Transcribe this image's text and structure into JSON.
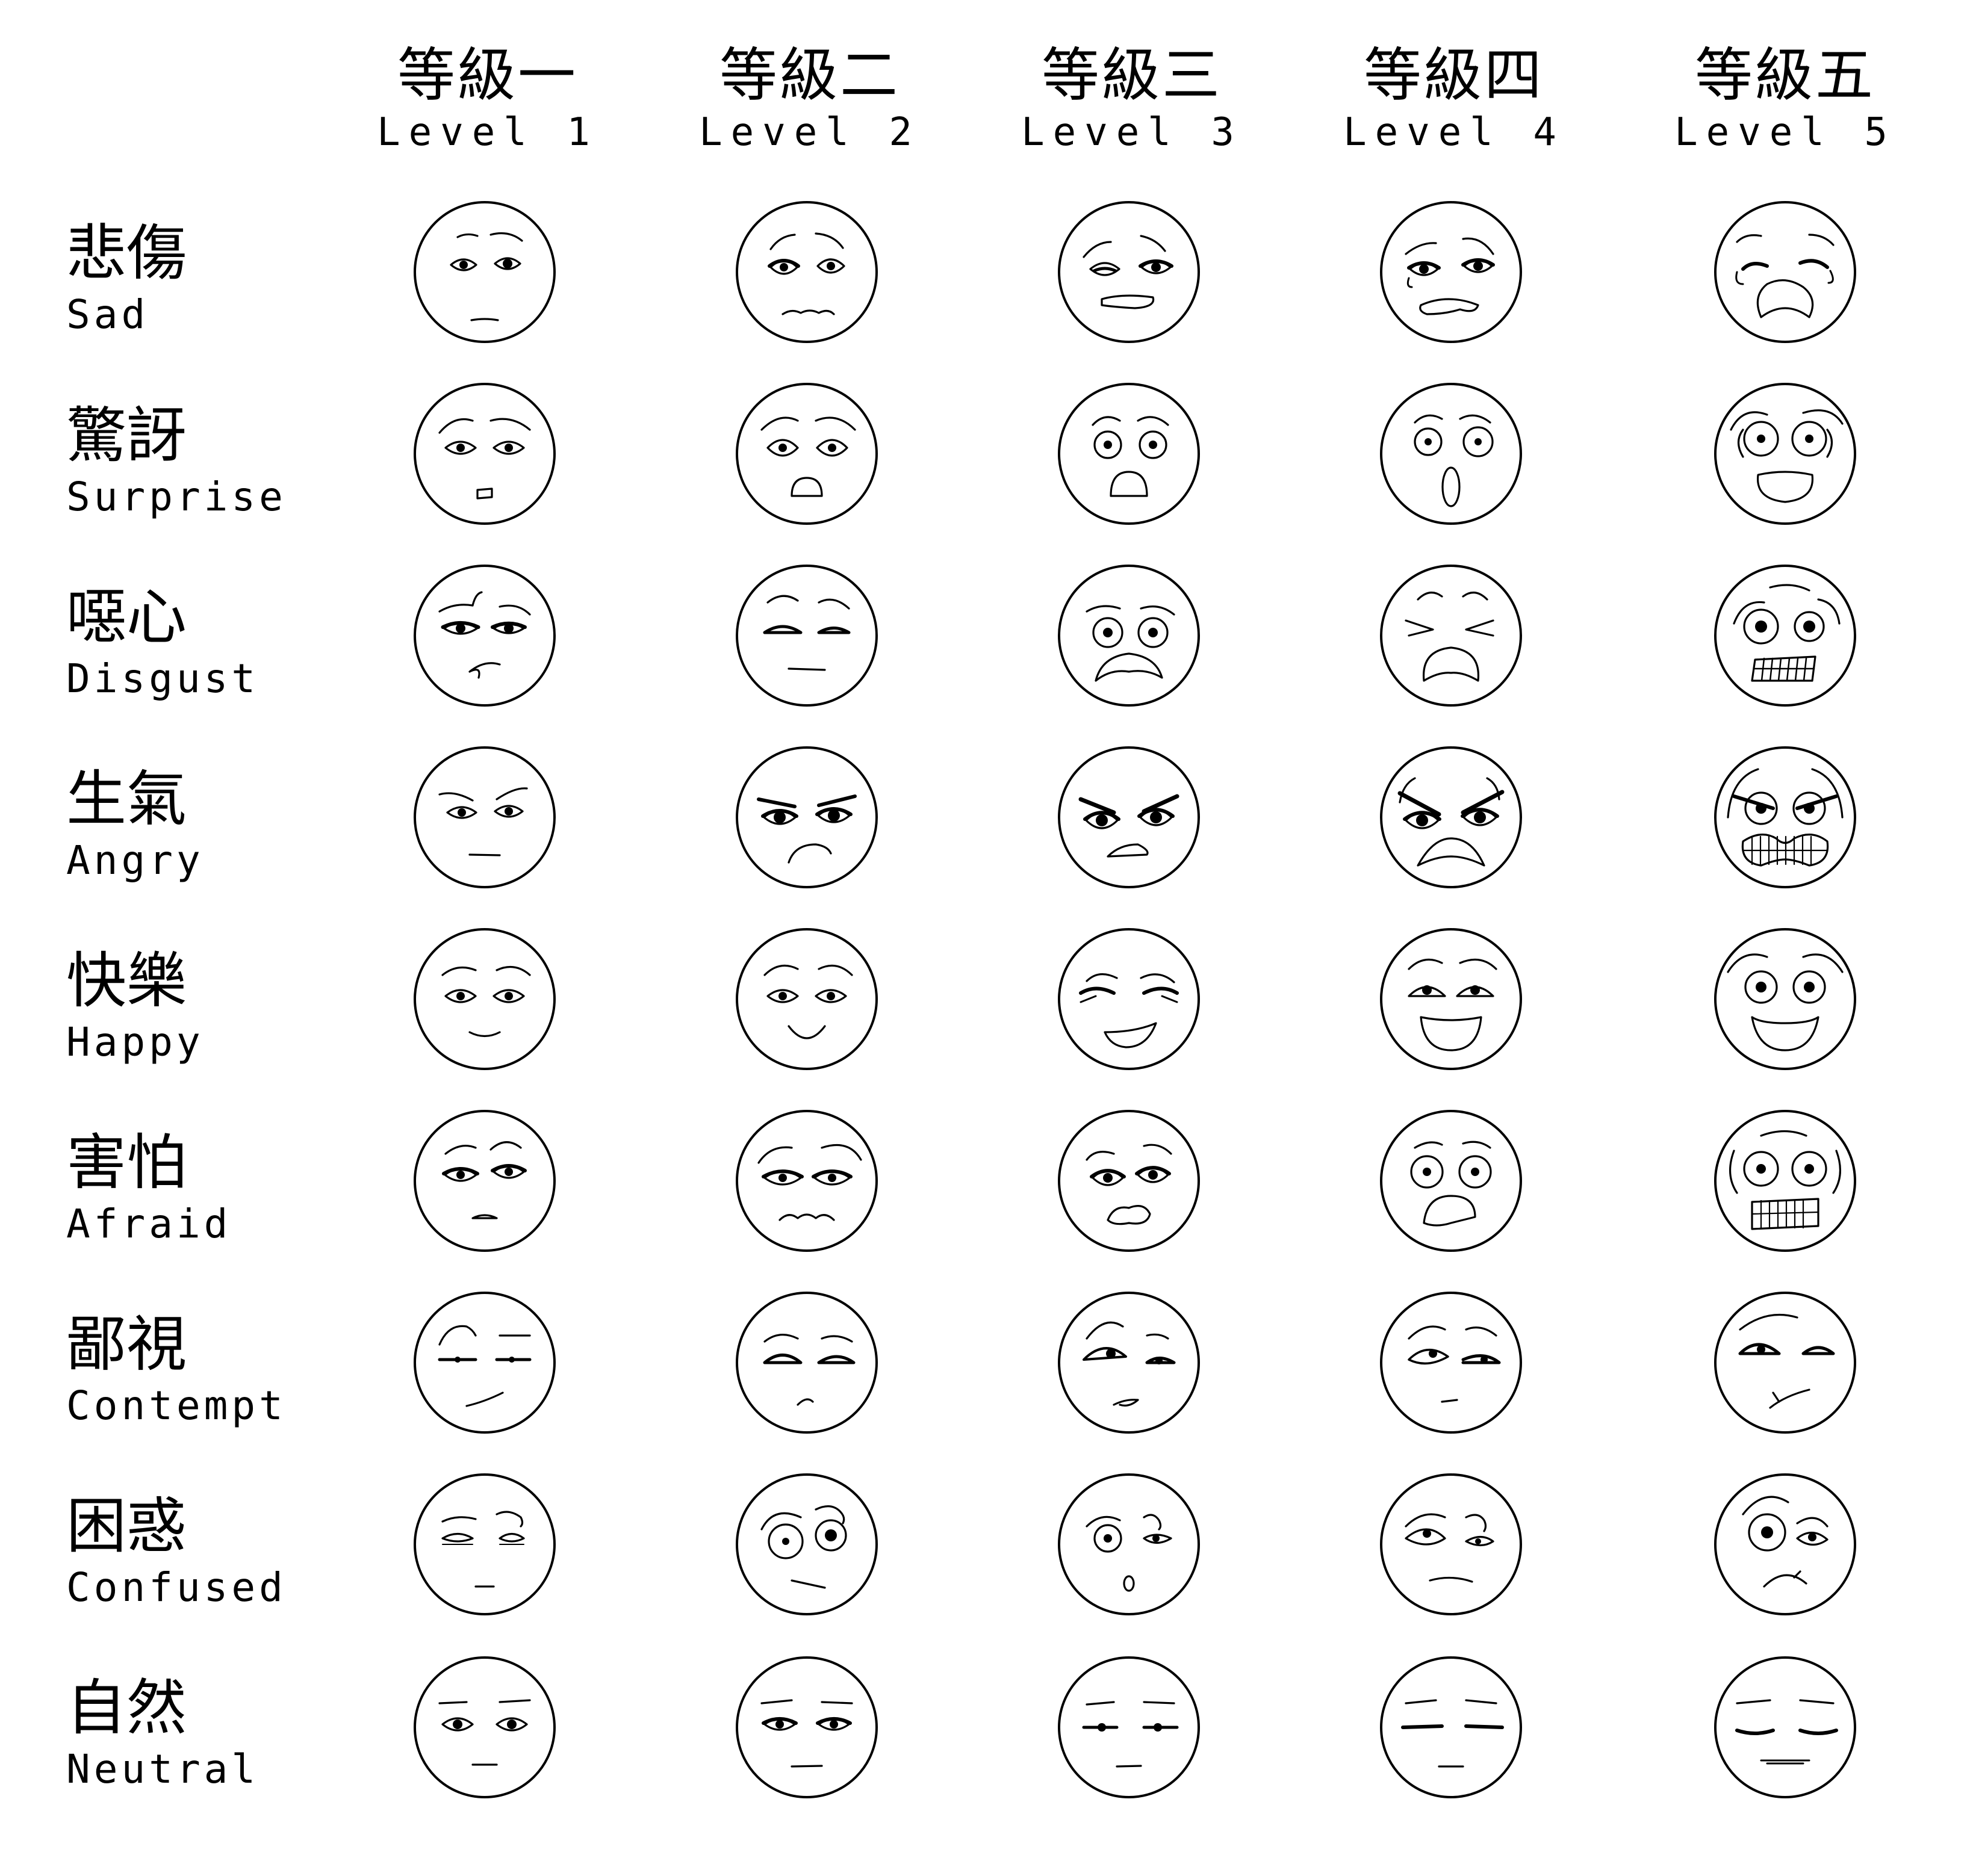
{
  "title": "",
  "columns": [
    {
      "zh": "等級一",
      "en": "Level 1"
    },
    {
      "zh": "等級二",
      "en": "Level 2"
    },
    {
      "zh": "等級三",
      "en": "Level 3"
    },
    {
      "zh": "等級四",
      "en": "Level 4"
    },
    {
      "zh": "等級五",
      "en": "Level 5"
    }
  ],
  "rows": [
    {
      "zh": "悲傷",
      "en": "Sad",
      "key": "sad"
    },
    {
      "zh": "驚訝",
      "en": "Surprise",
      "key": "surprise"
    },
    {
      "zh": "噁心",
      "en": "Disgust",
      "key": "disgust"
    },
    {
      "zh": "生氣",
      "en": "Angry",
      "key": "angry"
    },
    {
      "zh": "快樂",
      "en": "Happy",
      "key": "happy"
    },
    {
      "zh": "害怕",
      "en": "Afraid",
      "key": "afraid"
    },
    {
      "zh": "鄙視",
      "en": "Contempt",
      "key": "contempt"
    },
    {
      "zh": "困惑",
      "en": "Confused",
      "key": "confused"
    },
    {
      "zh": "自然",
      "en": "Neutral",
      "key": "neutral"
    }
  ],
  "colors": {
    "ink": "#000000",
    "background": "#ffffff"
  }
}
